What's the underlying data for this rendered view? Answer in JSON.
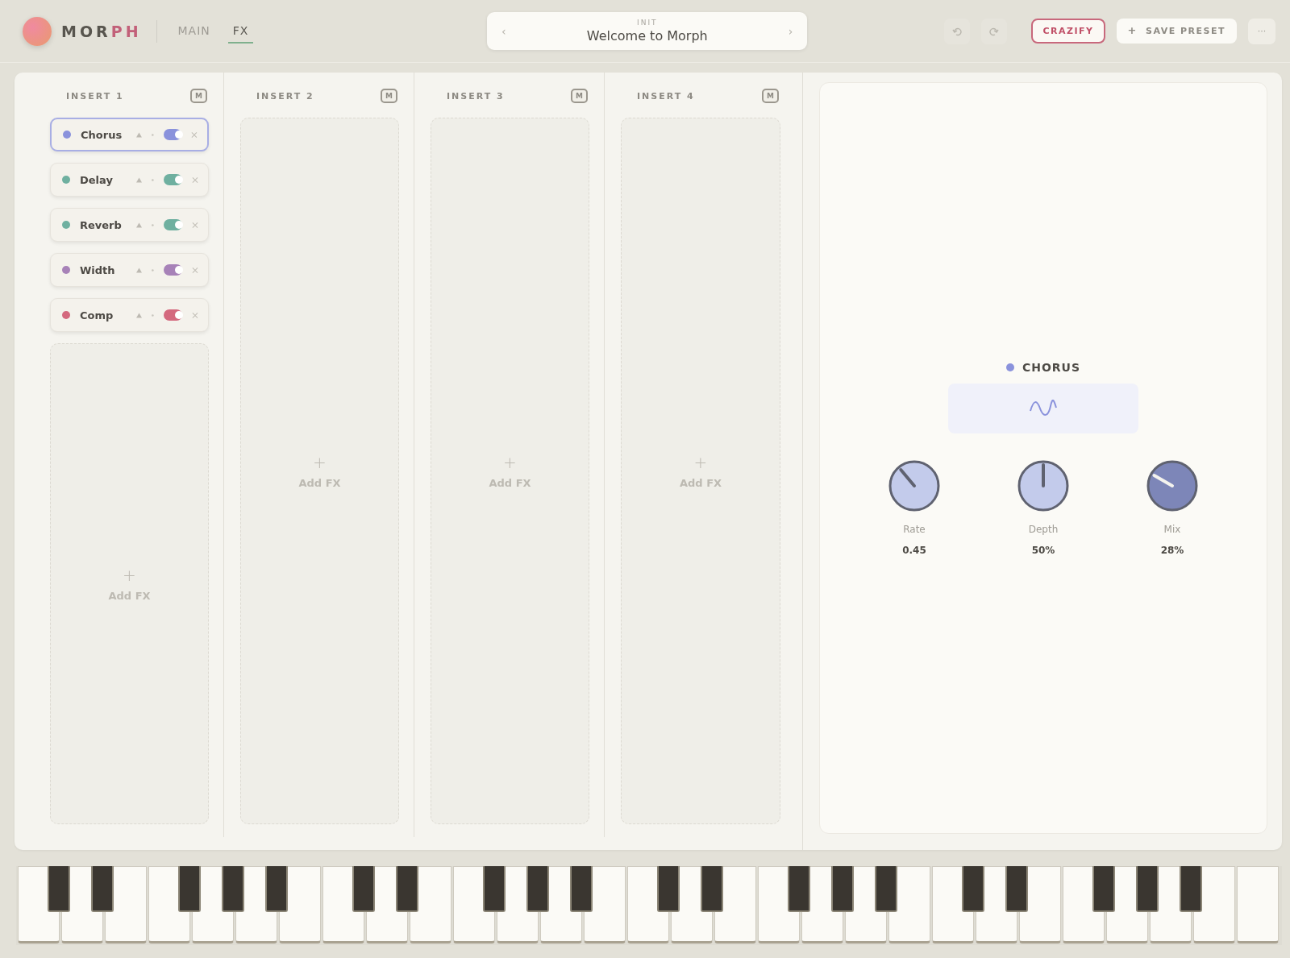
{
  "header": {
    "logo_text": "MOR",
    "logo_accent": "PH",
    "tabs": [
      {
        "label": "MAIN",
        "selected": false
      },
      {
        "label": "FX",
        "selected": true
      }
    ],
    "preset": {
      "bank": "INIT",
      "name": "Welcome to Morph",
      "prev": "‹",
      "next": "›"
    },
    "crazify": "CRAZIFY",
    "save": {
      "icon": "+",
      "label": "SAVE PRESET"
    },
    "more": "···"
  },
  "inserts": [
    {
      "title": "INSERT 1",
      "mute": "M",
      "add_label": "Add FX",
      "add_icon": "+",
      "effects": [
        {
          "name": "Chorus",
          "color": "#8a92dc",
          "enabled": true,
          "selected": true
        },
        {
          "name": "Delay",
          "color": "#6fb0a0",
          "enabled": true,
          "selected": false
        },
        {
          "name": "Reverb",
          "color": "#6fb0a0",
          "enabled": true,
          "selected": false
        },
        {
          "name": "Width",
          "color": "#a782b8",
          "enabled": true,
          "selected": false
        },
        {
          "name": "Comp",
          "color": "#d4697e",
          "enabled": true,
          "selected": false
        }
      ]
    },
    {
      "title": "INSERT 2",
      "mute": "M",
      "add_label": "Add FX",
      "add_icon": "+"
    },
    {
      "title": "INSERT 3",
      "mute": "M",
      "add_label": "Add FX",
      "add_icon": "+"
    },
    {
      "title": "INSERT 4",
      "mute": "M",
      "add_label": "Add FX",
      "add_icon": "+"
    }
  ],
  "editor": {
    "title": "CHORUS",
    "color": "#8a92dc",
    "knobs": [
      {
        "label": "Rate",
        "value": "0.45",
        "highlighted": false
      },
      {
        "label": "Depth",
        "value": "50%",
        "highlighted": false
      },
      {
        "label": "Mix",
        "value": "28%",
        "highlighted": true
      }
    ]
  }
}
